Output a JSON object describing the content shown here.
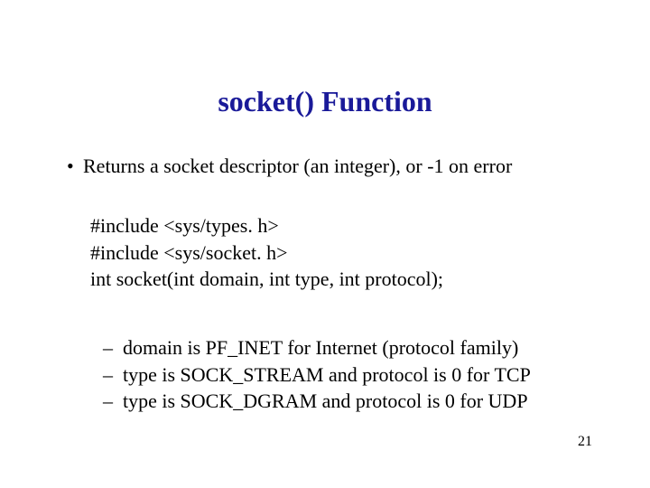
{
  "title": "socket() Function",
  "bullet": {
    "marker": "•",
    "text": "Returns a socket descriptor (an integer), or -1 on error"
  },
  "code": {
    "line1": "#include <sys/types. h>",
    "line2": "#include <sys/socket. h>",
    "line3": "int socket(int domain, int type, int protocol);"
  },
  "sub": {
    "marker": "–",
    "item1": "domain is PF_INET for  Internet (protocol family)",
    "item2": "type is SOCK_STREAM and protocol is 0 for TCP",
    "item3": "type is SOCK_DGRAM and protocol is 0 for UDP"
  },
  "page_number": "21"
}
